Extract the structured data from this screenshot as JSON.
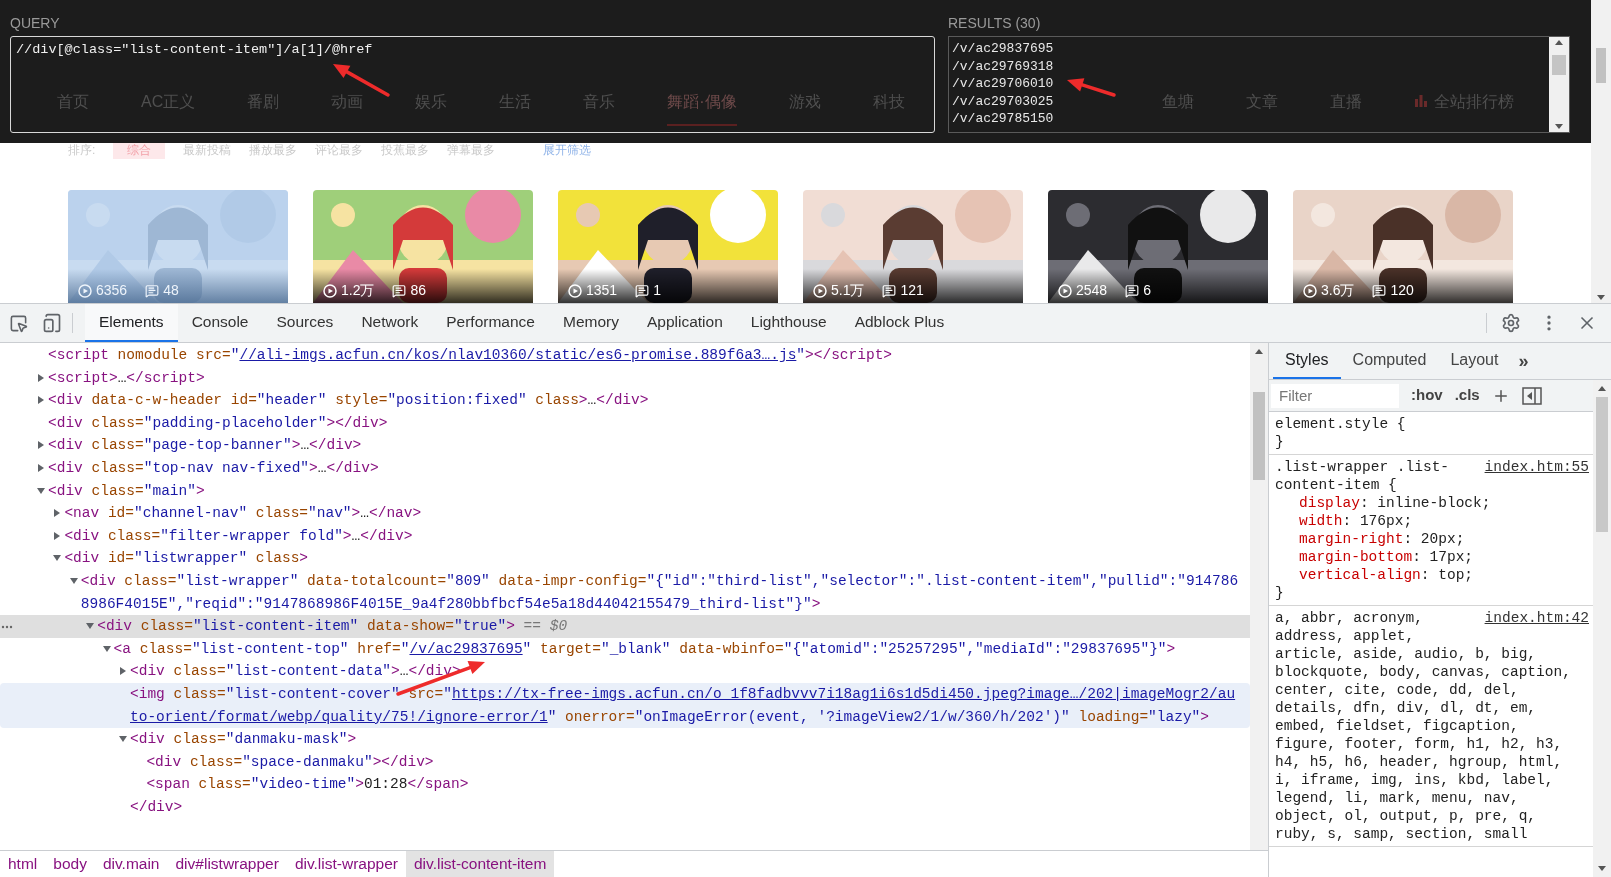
{
  "query": {
    "label": "QUERY",
    "value": "//div[@class=\"list-content-item\"]/a[1]/@href"
  },
  "results": {
    "label": "RESULTS (30)",
    "items": [
      "/v/ac29837695",
      "/v/ac29769318",
      "/v/ac29706010",
      "/v/ac29703025",
      "/v/ac29785150"
    ]
  },
  "site_nav": [
    {
      "label": "首页",
      "selected": false
    },
    {
      "label": "AC正义",
      "selected": false
    },
    {
      "label": "番剧",
      "selected": false
    },
    {
      "label": "动画",
      "selected": false
    },
    {
      "label": "娱乐",
      "selected": false
    },
    {
      "label": "生活",
      "selected": false
    },
    {
      "label": "音乐",
      "selected": false
    },
    {
      "label": "舞蹈·偶像",
      "selected": true
    },
    {
      "label": "游戏",
      "selected": false
    },
    {
      "label": "科技",
      "selected": false
    },
    {
      "label": "鱼塘",
      "selected": false
    },
    {
      "label": "文章",
      "selected": false
    },
    {
      "label": "直播",
      "selected": false
    },
    {
      "label": "全站排行榜",
      "selected": false
    }
  ],
  "sort_bar": {
    "label": "排序:",
    "options": [
      {
        "label": "综合",
        "selected": true
      },
      {
        "label": "最新投稿",
        "selected": false
      },
      {
        "label": "播放最多",
        "selected": false
      },
      {
        "label": "评论最多",
        "selected": false
      },
      {
        "label": "投蕉最多",
        "selected": false
      },
      {
        "label": "弹幕最多",
        "selected": false
      }
    ],
    "expand": "展开筛选"
  },
  "videos": [
    {
      "views": "6356",
      "comments": "48",
      "dimmed": true,
      "kind": "picture"
    },
    {
      "views": "1.2万",
      "comments": "86",
      "dimmed": false,
      "kind": "picture"
    },
    {
      "views": "1351",
      "comments": "1",
      "dimmed": false,
      "kind": "picture"
    },
    {
      "views": "5.1万",
      "comments": "121",
      "dimmed": false,
      "kind": "picture"
    },
    {
      "views": "2548",
      "comments": "6",
      "dimmed": false,
      "kind": "picture"
    },
    {
      "views": "3.6万",
      "comments": "120",
      "dimmed": false,
      "kind": "picture"
    }
  ],
  "devtools": {
    "tabs": [
      {
        "label": "Elements",
        "selected": true
      },
      {
        "label": "Console",
        "selected": false
      },
      {
        "label": "Sources",
        "selected": false
      },
      {
        "label": "Network",
        "selected": false
      },
      {
        "label": "Performance",
        "selected": false
      },
      {
        "label": "Memory",
        "selected": false
      },
      {
        "label": "Application",
        "selected": false
      },
      {
        "label": "Lighthouse",
        "selected": false
      },
      {
        "label": "Adblock Plus",
        "selected": false
      }
    ],
    "dom_tree": [
      {
        "selected": false,
        "hovered": false,
        "parts": [
          {
            "kind": "tag",
            "text": "<script"
          },
          {
            "kind": "attr",
            "text": " nomodule src="
          },
          {
            "kind": "value",
            "text": "\""
          },
          {
            "kind": "link",
            "text": "//ali-imgs.acfun.cn/kos/nlav10360/static/es6-promise.889f6a3….js"
          },
          {
            "kind": "value",
            "text": "\""
          },
          {
            "kind": "tag",
            "text": "></script>"
          }
        ]
      },
      {
        "expanded": false,
        "selected": false,
        "hovered": false,
        "parts": [
          {
            "kind": "tag",
            "text": "<script>"
          },
          {
            "kind": "text",
            "text": "…"
          },
          {
            "kind": "tag",
            "text": "</script>"
          }
        ]
      },
      {
        "expanded": false,
        "selected": false,
        "hovered": false,
        "parts": [
          {
            "kind": "tag",
            "text": "<div"
          },
          {
            "kind": "attr",
            "text": " data-c-w-header id="
          },
          {
            "kind": "value",
            "text": "\"header\""
          },
          {
            "kind": "attr",
            "text": " style="
          },
          {
            "kind": "value",
            "text": "\"position:fixed\""
          },
          {
            "kind": "attr",
            "text": " class"
          },
          {
            "kind": "tag",
            "text": ">"
          },
          {
            "kind": "text",
            "text": "…"
          },
          {
            "kind": "tag",
            "text": "</div>"
          }
        ]
      },
      {
        "selected": false,
        "hovered": false,
        "parts": [
          {
            "kind": "tag",
            "text": "<div"
          },
          {
            "kind": "attr",
            "text": " class="
          },
          {
            "kind": "value",
            "text": "\"padding-placeholder\""
          },
          {
            "kind": "tag",
            "text": "></div>"
          }
        ]
      },
      {
        "expanded": false,
        "selected": false,
        "hovered": false,
        "parts": [
          {
            "kind": "tag",
            "text": "<div"
          },
          {
            "kind": "attr",
            "text": " class="
          },
          {
            "kind": "value",
            "text": "\"page-top-banner\""
          },
          {
            "kind": "tag",
            "text": ">"
          },
          {
            "kind": "text",
            "text": "…"
          },
          {
            "kind": "tag",
            "text": "</div>"
          }
        ]
      },
      {
        "expanded": false,
        "selected": false,
        "hovered": false,
        "parts": [
          {
            "kind": "tag",
            "text": "<div"
          },
          {
            "kind": "attr",
            "text": " class="
          },
          {
            "kind": "value",
            "text": "\"top-nav nav-fixed\""
          },
          {
            "kind": "tag",
            "text": ">"
          },
          {
            "kind": "text",
            "text": "…"
          },
          {
            "kind": "tag",
            "text": "</div>"
          }
        ]
      },
      {
        "expanded": true,
        "selected": false,
        "hovered": false,
        "parts": [
          {
            "kind": "tag",
            "text": "<div"
          },
          {
            "kind": "attr",
            "text": " class="
          },
          {
            "kind": "value",
            "text": "\"main\""
          },
          {
            "kind": "tag",
            "text": ">"
          }
        ],
        "children": [
          {
            "expanded": false,
            "selected": false,
            "hovered": false,
            "parts": [
              {
                "kind": "tag",
                "text": "<nav"
              },
              {
                "kind": "attr",
                "text": " id="
              },
              {
                "kind": "value",
                "text": "\"channel-nav\""
              },
              {
                "kind": "attr",
                "text": " class="
              },
              {
                "kind": "value",
                "text": "\"nav\""
              },
              {
                "kind": "tag",
                "text": ">"
              },
              {
                "kind": "text",
                "text": "…"
              },
              {
                "kind": "tag",
                "text": "</nav>"
              }
            ]
          },
          {
            "expanded": false,
            "selected": false,
            "hovered": false,
            "parts": [
              {
                "kind": "tag",
                "text": "<div"
              },
              {
                "kind": "attr",
                "text": " class="
              },
              {
                "kind": "value",
                "text": "\"filter-wrapper fold\""
              },
              {
                "kind": "tag",
                "text": ">"
              },
              {
                "kind": "text",
                "text": "…"
              },
              {
                "kind": "tag",
                "text": "</div>"
              }
            ]
          },
          {
            "expanded": true,
            "selected": false,
            "hovered": false,
            "parts": [
              {
                "kind": "tag",
                "text": "<div"
              },
              {
                "kind": "attr",
                "text": " id="
              },
              {
                "kind": "value",
                "text": "\"listwrapper\""
              },
              {
                "kind": "attr",
                "text": " class"
              },
              {
                "kind": "tag",
                "text": ">"
              }
            ],
            "children": [
              {
                "expanded": true,
                "selected": false,
                "hovered": false,
                "parts": [
                  {
                    "kind": "tag",
                    "text": "<div"
                  },
                  {
                    "kind": "attr",
                    "text": " class="
                  },
                  {
                    "kind": "value",
                    "text": "\"list-wrapper\""
                  },
                  {
                    "kind": "attr",
                    "text": " data-totalcount="
                  },
                  {
                    "kind": "value",
                    "text": "\"809\""
                  },
                  {
                    "kind": "attr",
                    "text": " data-impr-config="
                  },
                  {
                    "kind": "value",
                    "text": "\"{\"id\":\"third-list\",\"selector\":\".list-content-item\",\"pullid\":\"9147868986F4015E\",\"reqid\":\"9147868986F4015E_9a4f280bbfbcf54e5a18d44042155479_third-list\"}\""
                  },
                  {
                    "kind": "tag",
                    "text": ">"
                  }
                ],
                "children": [
                  {
                    "expanded": true,
                    "selected": true,
                    "hovered": false,
                    "parts": [
                      {
                        "kind": "tag",
                        "text": "<div"
                      },
                      {
                        "kind": "attr",
                        "text": " class="
                      },
                      {
                        "kind": "value",
                        "text": "\"list-content-item\""
                      },
                      {
                        "kind": "attr",
                        "text": " data-show="
                      },
                      {
                        "kind": "value",
                        "text": "\"true\""
                      },
                      {
                        "kind": "tag",
                        "text": ">"
                      },
                      {
                        "kind": "note",
                        "text": " == $0"
                      }
                    ],
                    "children": [
                      {
                        "expanded": true,
                        "selected": false,
                        "hovered": false,
                        "parts": [
                          {
                            "kind": "tag",
                            "text": "<a"
                          },
                          {
                            "kind": "attr",
                            "text": " class="
                          },
                          {
                            "kind": "value",
                            "text": "\"list-content-top\""
                          },
                          {
                            "kind": "attr",
                            "text": " href="
                          },
                          {
                            "kind": "value",
                            "text": "\""
                          },
                          {
                            "kind": "link",
                            "text": "/v/ac29837695"
                          },
                          {
                            "kind": "value",
                            "text": "\""
                          },
                          {
                            "kind": "attr",
                            "text": " target="
                          },
                          {
                            "kind": "value",
                            "text": "\"_blank\""
                          },
                          {
                            "kind": "attr",
                            "text": " data-wbinfo="
                          },
                          {
                            "kind": "value",
                            "text": "\"{\"atomid\":\"25257295\",\"mediaId\":\"29837695\"}\""
                          },
                          {
                            "kind": "tag",
                            "text": ">"
                          }
                        ],
                        "children": [
                          {
                            "expanded": false,
                            "selected": false,
                            "hovered": false,
                            "parts": [
                              {
                                "kind": "tag",
                                "text": "<div"
                              },
                              {
                                "kind": "attr",
                                "text": " class="
                              },
                              {
                                "kind": "value",
                                "text": "\"list-content-data\""
                              },
                              {
                                "kind": "tag",
                                "text": ">"
                              },
                              {
                                "kind": "text",
                                "text": "…"
                              },
                              {
                                "kind": "tag",
                                "text": "</div>"
                              }
                            ]
                          },
                          {
                            "selected": false,
                            "hovered": true,
                            "parts": [
                              {
                                "kind": "tag",
                                "text": "<img"
                              },
                              {
                                "kind": "attr",
                                "text": " class="
                              },
                              {
                                "kind": "value",
                                "text": "\"list-content-cover\""
                              },
                              {
                                "kind": "attr",
                                "text": " src="
                              },
                              {
                                "kind": "value",
                                "text": "\""
                              },
                              {
                                "kind": "link",
                                "text": "https://tx-free-imgs.acfun.cn/o_1f8fadbvvv7i18ag1i6s1d5di450.jpeg?image…/202|imageMogr2/auto-orient/format/webp/quality/75!/ignore-error/1"
                              },
                              {
                                "kind": "value",
                                "text": "\""
                              },
                              {
                                "kind": "attr",
                                "text": " onerror="
                              },
                              {
                                "kind": "value",
                                "text": "\"onImageError(event, '?imageView2/1/w/360/h/202')\""
                              },
                              {
                                "kind": "attr",
                                "text": " loading="
                              },
                              {
                                "kind": "value",
                                "text": "\"lazy\""
                              },
                              {
                                "kind": "tag",
                                "text": ">"
                              }
                            ]
                          },
                          {
                            "expanded": true,
                            "selected": false,
                            "hovered": false,
                            "parts": [
                              {
                                "kind": "tag",
                                "text": "<div"
                              },
                              {
                                "kind": "attr",
                                "text": " class="
                              },
                              {
                                "kind": "value",
                                "text": "\"danmaku-mask\""
                              },
                              {
                                "kind": "tag",
                                "text": ">"
                              }
                            ],
                            "children": [
                              {
                                "selected": false,
                                "hovered": false,
                                "parts": [
                                  {
                                    "kind": "tag",
                                    "text": "<div"
                                  },
                                  {
                                    "kind": "attr",
                                    "text": " class="
                                  },
                                  {
                                    "kind": "value",
                                    "text": "\"space-danmaku\""
                                  },
                                  {
                                    "kind": "tag",
                                    "text": "></div>"
                                  }
                                ]
                              },
                              {
                                "selected": false,
                                "hovered": false,
                                "parts": [
                                  {
                                    "kind": "tag",
                                    "text": "<span"
                                  },
                                  {
                                    "kind": "attr",
                                    "text": " class="
                                  },
                                  {
                                    "kind": "value",
                                    "text": "\"video-time\""
                                  },
                                  {
                                    "kind": "tag",
                                    "text": ">"
                                  },
                                  {
                                    "kind": "text",
                                    "text": "01:28"
                                  },
                                  {
                                    "kind": "tag",
                                    "text": "</span>"
                                  }
                                ]
                              }
                            ]
                          },
                          {
                            "selected": false,
                            "hovered": false,
                            "parts": [
                              {
                                "kind": "tag",
                                "text": "</div>"
                              }
                            ]
                          }
                        ]
                      }
                    ]
                  }
                ]
              }
            ]
          }
        ]
      }
    ],
    "breadcrumbs": [
      {
        "label": "html",
        "selected": false
      },
      {
        "label": "body",
        "selected": false
      },
      {
        "label": "div.main",
        "selected": false
      },
      {
        "label": "div#listwrapper",
        "selected": false
      },
      {
        "label": "div.list-wrapper",
        "selected": false
      },
      {
        "label": "div.list-content-item",
        "selected": true
      }
    ],
    "styles_panel": {
      "tabs": [
        {
          "label": "Styles",
          "selected": true
        },
        {
          "label": "Computed",
          "selected": false
        },
        {
          "label": "Layout",
          "selected": false
        }
      ],
      "more": "»",
      "filter_placeholder": "Filter",
      "hov": ":hov",
      "cls": ".cls",
      "rules": [
        {
          "selector": "element.style {",
          "close": "}"
        },
        {
          "selector": ".list-wrapper .list-content-item {",
          "source": "index.htm:55",
          "declarations": [
            {
              "property": "display",
              "separator": ":",
              "value": "inline-block;"
            },
            {
              "property": "width",
              "separator": ":",
              "value": "176px;"
            },
            {
              "property": "margin-right",
              "separator": ":",
              "value": "20px;"
            },
            {
              "property": "margin-bottom",
              "separator": ":",
              "value": "17px;"
            },
            {
              "property": "vertical-align",
              "separator": ":",
              "value": "top;"
            }
          ],
          "close": "}"
        },
        {
          "selector_lines": [
            "a, abbr, acronym,",
            "address, applet,",
            "article, aside, audio, b, big,",
            "blockquote, body, canvas, caption,",
            "center, cite, code, dd, del,",
            "details, dfn, div, dl, dt, em,",
            "embed, fieldset, figcaption,",
            "figure, footer, form, h1, h2, h3,",
            "h4, h5, h6, header, hgroup, html,",
            "i, iframe, img, ins, kbd, label,",
            "legend, li, mark, menu, nav,",
            "object, ol, output, p, pre, q,",
            "ruby, s, samp, section, small"
          ],
          "source": "index.htm:42"
        }
      ]
    }
  }
}
